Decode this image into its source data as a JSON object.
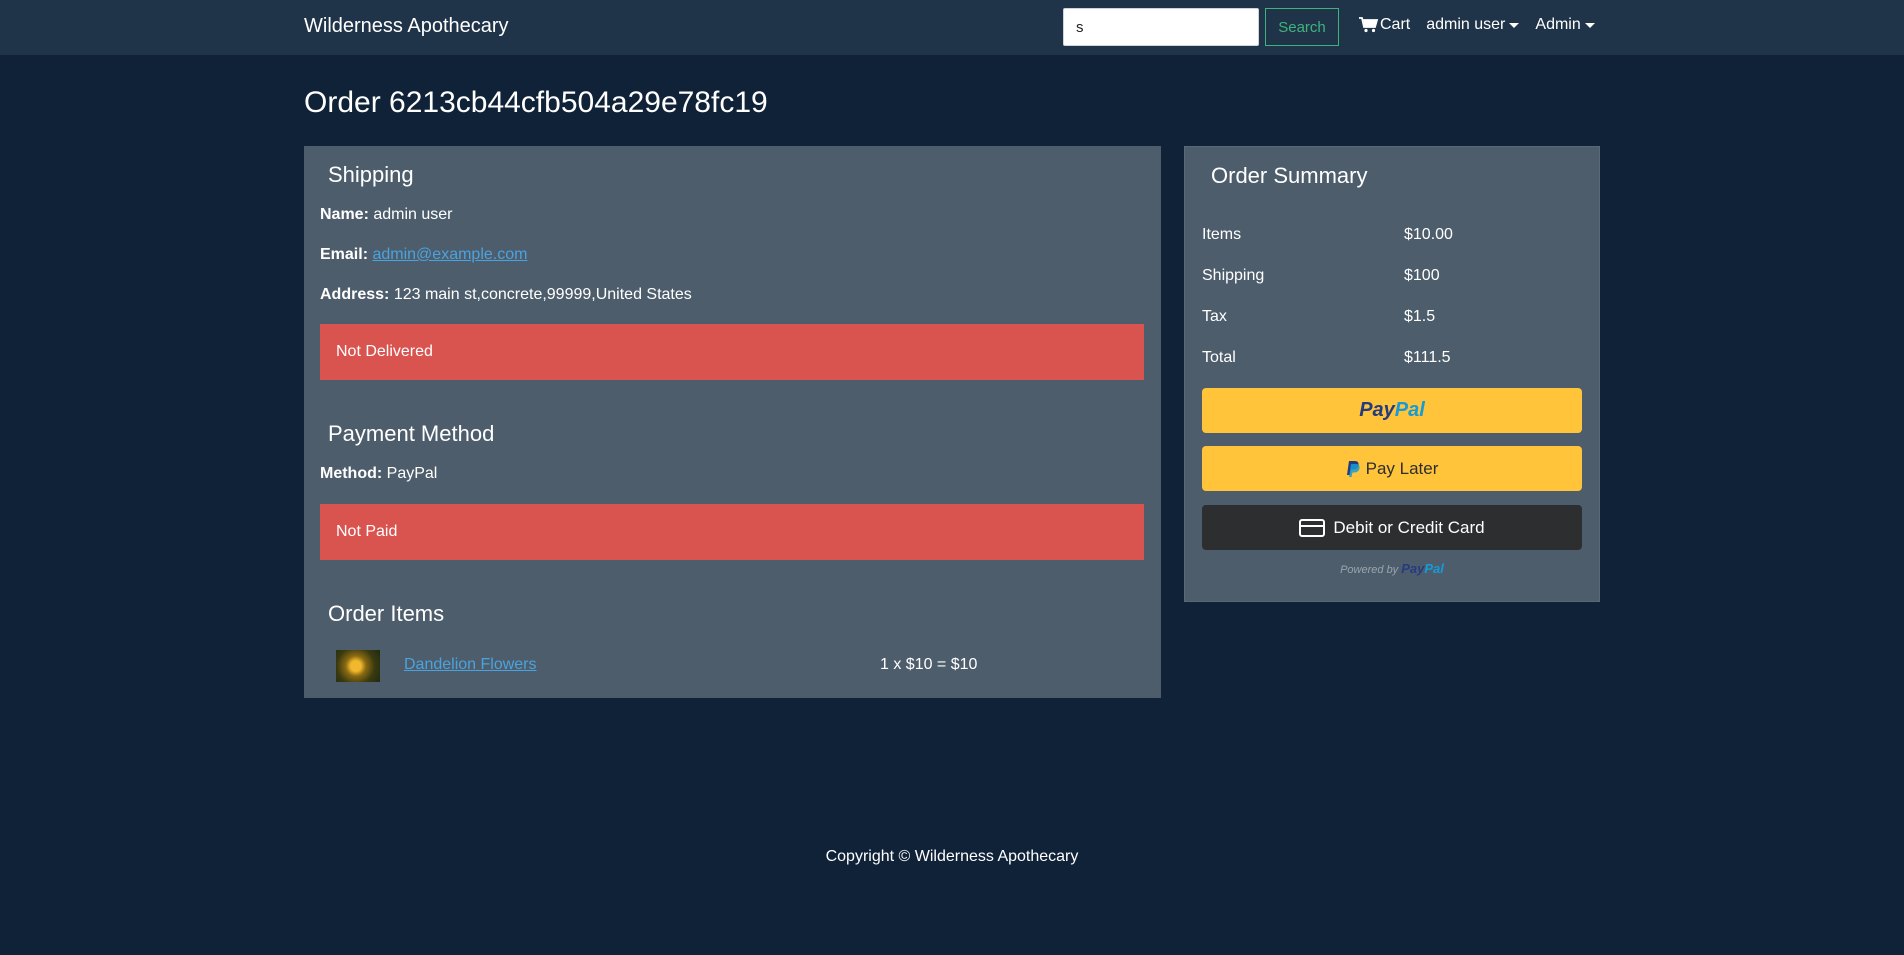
{
  "navbar": {
    "brand": "Wilderness Apothecary",
    "search_value": "s",
    "search_button": "Search",
    "cart_label": "Cart",
    "user_menu": "admin user",
    "admin_menu": "Admin"
  },
  "page": {
    "title": "Order 6213cb44cfb504a29e78fc19"
  },
  "shipping": {
    "heading": "Shipping",
    "name_label": "Name:",
    "name_value": "admin user",
    "email_label": "Email:",
    "email_value": "admin@example.com",
    "address_label": "Address:",
    "address_value": "123 main st,concrete,99999,United States",
    "status": "Not Delivered"
  },
  "payment": {
    "heading": "Payment Method",
    "method_label": "Method:",
    "method_value": "PayPal",
    "status": "Not Paid"
  },
  "order_items": {
    "heading": "Order Items",
    "items": [
      {
        "name": "Dandelion Flowers",
        "qty_price": "1 x $10 = $10"
      }
    ]
  },
  "summary": {
    "heading": "Order Summary",
    "rows": [
      {
        "label": "Items",
        "value": "$10.00"
      },
      {
        "label": "Shipping",
        "value": "$100"
      },
      {
        "label": "Tax",
        "value": "$1.5"
      },
      {
        "label": "Total",
        "value": "$111.5"
      }
    ],
    "paypal_pay": "Pay",
    "paypal_pal": "Pal",
    "pay_later": "Pay Later",
    "card_button": "Debit or Credit Card",
    "powered_by": "Powered by"
  },
  "footer": {
    "copyright": "Copyright © Wilderness Apothecary"
  },
  "colors": {
    "background": "#0f2237",
    "navbar": "#203449",
    "card": "#4e5d6c",
    "alert_danger": "#d9534f",
    "paypal_yellow": "#ffc439",
    "link": "#4aa3df",
    "success_outline": "#3fb37f"
  }
}
